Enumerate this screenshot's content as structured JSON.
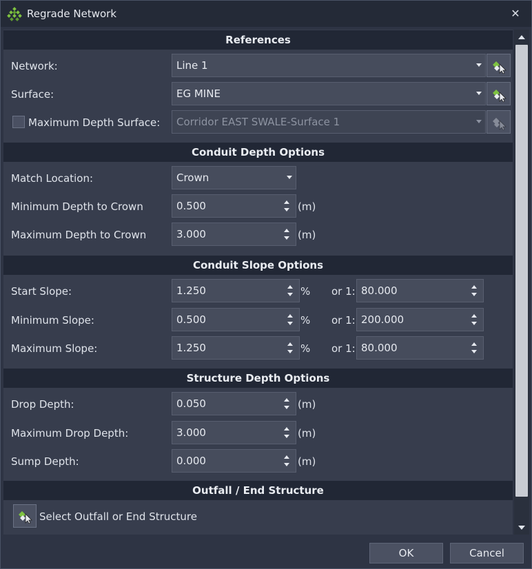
{
  "window": {
    "title": "Regrade Network",
    "close_icon": "close-icon",
    "app_icon": "regrade-network-icon"
  },
  "colors": {
    "background": "#2e3444",
    "section_header": "#212735",
    "field": "#464c5c",
    "accent_green": "#7ec241"
  },
  "references": {
    "header": "References",
    "network_label": "Network:",
    "network_value": "Line 1",
    "surface_label": "Surface:",
    "surface_value": "EG MINE",
    "max_depth_surface_label": "Maximum Depth Surface:",
    "max_depth_surface_checked": false,
    "max_depth_surface_value": "Corridor EAST SWALE-Surface 1",
    "pick_icon": "pick-from-drawing-icon"
  },
  "conduit_depth": {
    "header": "Conduit Depth Options",
    "match_location_label": "Match Location:",
    "match_location_value": "Crown",
    "min_depth_label": "Minimum Depth to Crown",
    "min_depth_value": "0.500",
    "max_depth_label": "Maximum Depth to Crown",
    "max_depth_value": "3.000",
    "unit": "(m)"
  },
  "conduit_slope": {
    "header": "Conduit Slope Options",
    "percent_unit": "%",
    "ratio_label": "or 1:",
    "rows": [
      {
        "label": "Start Slope:",
        "percent": "1.250",
        "ratio": "80.000"
      },
      {
        "label": "Minimum Slope:",
        "percent": "0.500",
        "ratio": "200.000"
      },
      {
        "label": "Maximum Slope:",
        "percent": "1.250",
        "ratio": "80.000"
      }
    ]
  },
  "structure_depth": {
    "header": "Structure Depth Options",
    "unit": "(m)",
    "rows": [
      {
        "label": "Drop Depth:",
        "value": "0.050"
      },
      {
        "label": "Maximum Drop Depth:",
        "value": "3.000"
      },
      {
        "label": "Sump Depth:",
        "value": "0.000"
      }
    ]
  },
  "outfall": {
    "header": "Outfall / End Structure",
    "select_label": "Select Outfall or End Structure"
  },
  "footer": {
    "ok_label": "OK",
    "cancel_label": "Cancel"
  }
}
